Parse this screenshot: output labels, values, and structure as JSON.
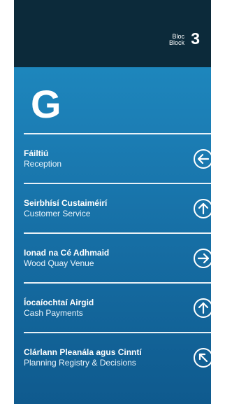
{
  "block": {
    "irish_word": "Bloc",
    "english_word": "Block",
    "number": "3"
  },
  "floor": {
    "letter": "G"
  },
  "directions": [
    {
      "irish": "Fáiltiú",
      "english": "Reception",
      "arrow": "arrow-left-icon"
    },
    {
      "irish": "Seirbhísí Custaiméirí",
      "english": "Customer Service",
      "arrow": "arrow-up-icon"
    },
    {
      "irish": "Ionad na Cé Adhmaid",
      "english": "Wood Quay Venue",
      "arrow": "arrow-right-icon"
    },
    {
      "irish": "Íocaíochtaí Airgid",
      "english": "Cash Payments",
      "arrow": "arrow-up-icon"
    },
    {
      "irish": "Clárlann Pleanála agus Cinntí",
      "english": "Planning Registry & Decisions",
      "arrow": "arrow-up-left-icon"
    }
  ],
  "colors": {
    "panel_blue": "#1c7fb6",
    "header_dark": "#0c2a3a",
    "text": "#ffffff"
  }
}
